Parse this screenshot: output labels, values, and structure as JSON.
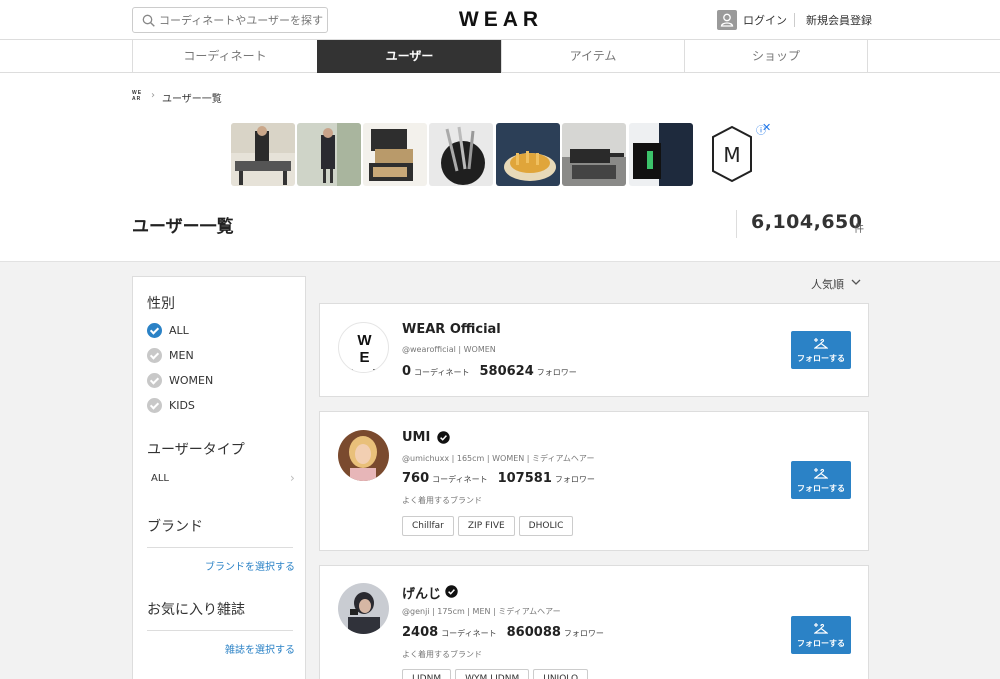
{
  "header": {
    "search_placeholder": "コーディネートやユーザーを探す",
    "logo": "WEAR",
    "login": "ログイン",
    "register": "新規会員登録"
  },
  "tabs": [
    {
      "label": "コーディネート",
      "active": false
    },
    {
      "label": "ユーザー",
      "active": true
    },
    {
      "label": "アイテム",
      "active": false
    },
    {
      "label": "ショップ",
      "active": false
    }
  ],
  "breadcrumb": {
    "home_logo": "WEAR",
    "current": "ユーザー一覧"
  },
  "ad": {
    "brand_letter": "M",
    "close": "✕"
  },
  "page": {
    "title": "ユーザー一覧",
    "count": "6,104,650",
    "count_unit": "件"
  },
  "sidebar": {
    "gender_heading": "性別",
    "genders": [
      {
        "label": "ALL",
        "checked": true
      },
      {
        "label": "MEN",
        "checked": false
      },
      {
        "label": "WOMEN",
        "checked": false
      },
      {
        "label": "KIDS",
        "checked": false
      }
    ],
    "usertype_heading": "ユーザータイプ",
    "usertype_value": "ALL",
    "brand_heading": "ブランド",
    "brand_link": "ブランドを選択する",
    "magazine_heading": "お気に入り雑誌",
    "magazine_link": "雑誌を選択する"
  },
  "sort": {
    "label": "人気順"
  },
  "users": [
    {
      "name": "WEAR Official",
      "avatar_text": "WEAR",
      "verified": false,
      "meta": "@wearofficial | WOMEN",
      "coordinates": "0",
      "coordinates_unit": "コーディネート",
      "followers": "580624",
      "followers_unit": "フォロワー",
      "brand_label": "",
      "brands": [],
      "follow_label": "フォローする"
    },
    {
      "name": "UMI",
      "verified": true,
      "meta": "@umichuxx | 165cm | WOMEN | ミディアムヘアー",
      "coordinates": "760",
      "coordinates_unit": "コーディネート",
      "followers": "107581",
      "followers_unit": "フォロワー",
      "brand_label": "よく着用するブランド",
      "brands": [
        "Chillfar",
        "ZIP FIVE",
        "DHOLIC"
      ],
      "follow_label": "フォローする"
    },
    {
      "name": "げんじ",
      "verified": true,
      "meta": "@genji | 175cm | MEN | ミディアムヘアー",
      "coordinates": "2408",
      "coordinates_unit": "コーディネート",
      "followers": "860088",
      "followers_unit": "フォロワー",
      "brand_label": "よく着用するブランド",
      "brands": [
        "LIDNM",
        "WYM LIDNM",
        "UNIQLO"
      ],
      "follow_label": "フォローする"
    }
  ],
  "colors": {
    "accent": "#2b82c6",
    "tab_active": "#333333"
  }
}
